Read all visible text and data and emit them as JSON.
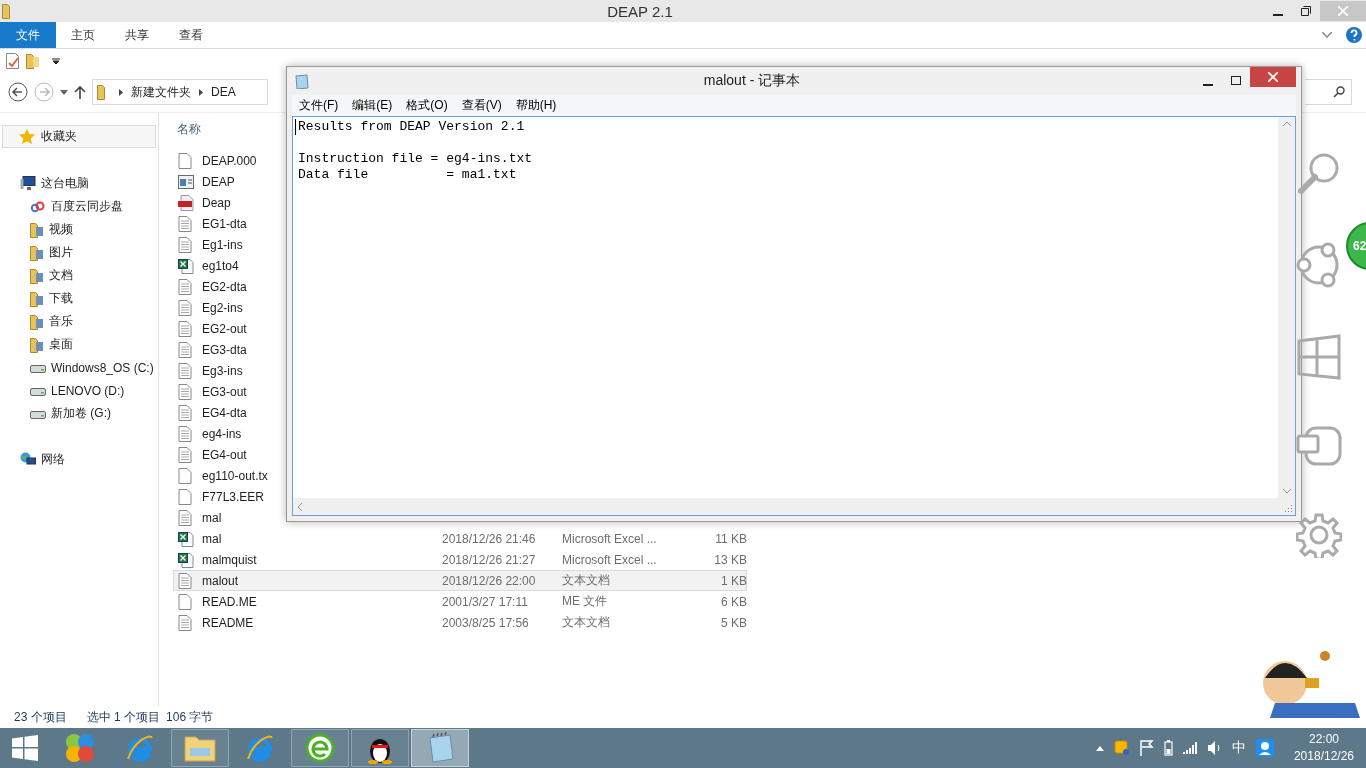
{
  "explorer": {
    "title": "DEAP 2.1",
    "ribbon_tabs": [
      {
        "label": "文件",
        "selected": true
      },
      {
        "label": "主页",
        "selected": false
      },
      {
        "label": "共享",
        "selected": false
      },
      {
        "label": "查看",
        "selected": false
      }
    ],
    "breadcrumb": [
      "新建文件夹",
      "DEA"
    ],
    "favorites": "收藏夹",
    "nav": [
      {
        "label": "这台电脑",
        "kind": "pc",
        "children": [
          {
            "label": "百度云同步盘",
            "kind": "cloud"
          },
          {
            "label": "视频",
            "kind": "folder"
          },
          {
            "label": "图片",
            "kind": "folder"
          },
          {
            "label": "文档",
            "kind": "folder"
          },
          {
            "label": "下载",
            "kind": "folder"
          },
          {
            "label": "音乐",
            "kind": "folder"
          },
          {
            "label": "桌面",
            "kind": "folder"
          },
          {
            "label": "Windows8_OS (C:)",
            "kind": "drive"
          },
          {
            "label": "LENOVO (D:)",
            "kind": "drive"
          },
          {
            "label": "新加卷 (G:)",
            "kind": "drive"
          }
        ]
      },
      {
        "label": "网络",
        "kind": "network"
      }
    ],
    "column_header": "名称",
    "files": [
      {
        "name": "DEAP.000",
        "kind": "blank",
        "selected": false
      },
      {
        "name": "DEAP",
        "kind": "app",
        "selected": false
      },
      {
        "name": "Deap",
        "kind": "pdf",
        "selected": false
      },
      {
        "name": "EG1-dta",
        "kind": "text",
        "selected": false
      },
      {
        "name": "Eg1-ins",
        "kind": "text",
        "selected": false
      },
      {
        "name": "eg1to4",
        "kind": "excel",
        "selected": false
      },
      {
        "name": "EG2-dta",
        "kind": "text",
        "selected": false
      },
      {
        "name": "Eg2-ins",
        "kind": "text",
        "selected": false
      },
      {
        "name": "EG2-out",
        "kind": "text",
        "selected": false
      },
      {
        "name": "EG3-dta",
        "kind": "text",
        "selected": false
      },
      {
        "name": "Eg3-ins",
        "kind": "text",
        "selected": false
      },
      {
        "name": "EG3-out",
        "kind": "text",
        "selected": false
      },
      {
        "name": "EG4-dta",
        "kind": "text",
        "selected": false
      },
      {
        "name": "eg4-ins",
        "kind": "text",
        "selected": false
      },
      {
        "name": "EG4-out",
        "kind": "text",
        "selected": false
      },
      {
        "name": "eg110-out.tx",
        "kind": "blank",
        "selected": false
      },
      {
        "name": "F77L3.EER",
        "kind": "blank",
        "selected": false
      },
      {
        "name": "mal",
        "kind": "text",
        "selected": false
      },
      {
        "name": "mal",
        "kind": "excel",
        "date": "2018/12/26 21:46",
        "type": "Microsoft Excel ...",
        "size": "11 KB",
        "selected": false
      },
      {
        "name": "malmquist",
        "kind": "excel",
        "date": "2018/12/26 21:27",
        "type": "Microsoft Excel ...",
        "size": "13 KB",
        "selected": false
      },
      {
        "name": "malout",
        "kind": "text",
        "date": "2018/12/26 22:00",
        "type": "文本文档",
        "size": "1 KB",
        "selected": true
      },
      {
        "name": "READ.ME",
        "kind": "blank",
        "date": "2001/3/27 17:11",
        "type": "ME 文件",
        "size": "6 KB",
        "selected": false
      },
      {
        "name": "README",
        "kind": "text",
        "date": "2003/8/25 17:56",
        "type": "文本文档",
        "size": "5 KB",
        "selected": false
      }
    ],
    "status": {
      "count": "23 个项目",
      "selection": "选中 1 个项目",
      "size": "106 字节"
    }
  },
  "notepad": {
    "title": "malout - 记事本",
    "menu": [
      "文件(F)",
      "编辑(E)",
      "格式(O)",
      "查看(V)",
      "帮助(H)"
    ],
    "text": "Results from DEAP Version 2.1\n\nInstruction file = eg4-ins.txt\nData file          = ma1.txt"
  },
  "charm_badge": "62",
  "taskbar": {
    "apps": [
      {
        "kind": "colorful",
        "running": false,
        "selected": false
      },
      {
        "kind": "ie",
        "running": false,
        "selected": false
      },
      {
        "kind": "folder",
        "running": true,
        "selected": false
      },
      {
        "kind": "ie",
        "running": false,
        "selected": false
      },
      {
        "kind": "green-e",
        "running": true,
        "selected": false
      },
      {
        "kind": "penguin",
        "running": true,
        "selected": false
      },
      {
        "kind": "notepad",
        "running": true,
        "selected": true
      }
    ],
    "ime": "中",
    "time": "22:00",
    "date": "2018/12/26"
  }
}
